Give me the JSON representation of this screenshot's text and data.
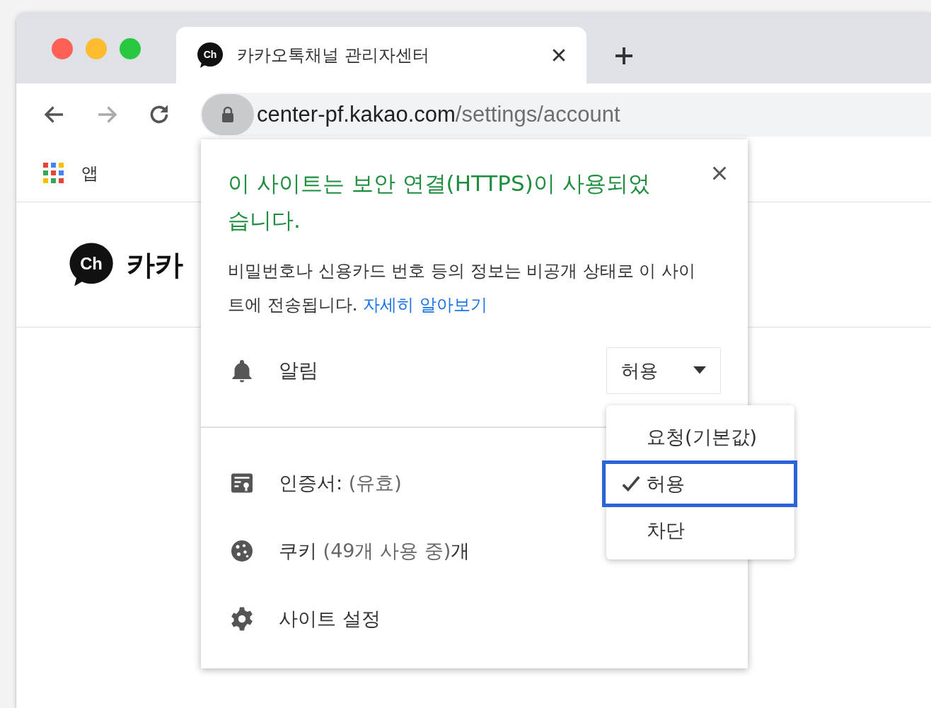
{
  "tab": {
    "favicon_text": "Ch",
    "title": "카카오톡채널 관리자센터",
    "selected": true
  },
  "address": {
    "host": "center-pf.kakao.com",
    "path": "/settings/account"
  },
  "bookmarks": [
    {
      "label": "앱"
    }
  ],
  "page": {
    "logo_text": "Ch",
    "brand": "카카"
  },
  "popup": {
    "heading": "이 사이트는 보안 연결(HTTPS)이 사용되었습니다.",
    "body": "비밀번호나 신용카드 번호 등의 정보는 비공개 상태로 이 사이트에 전송됩니다.",
    "link": "자세히 알아보기",
    "permission": {
      "label": "알림",
      "value": "허용"
    },
    "menu": [
      {
        "label": "요청(기본값)",
        "selected": false
      },
      {
        "label": "허용",
        "selected": true
      },
      {
        "label": "차단",
        "selected": false
      }
    ],
    "items": [
      {
        "kind": "certificate",
        "label": "인증서:",
        "detail": "(유효)"
      },
      {
        "kind": "cookies",
        "label": "쿠키",
        "detail": "(49개 사용 중)",
        "suffix": "개"
      },
      {
        "kind": "settings",
        "label": "사이트 설정"
      }
    ]
  }
}
